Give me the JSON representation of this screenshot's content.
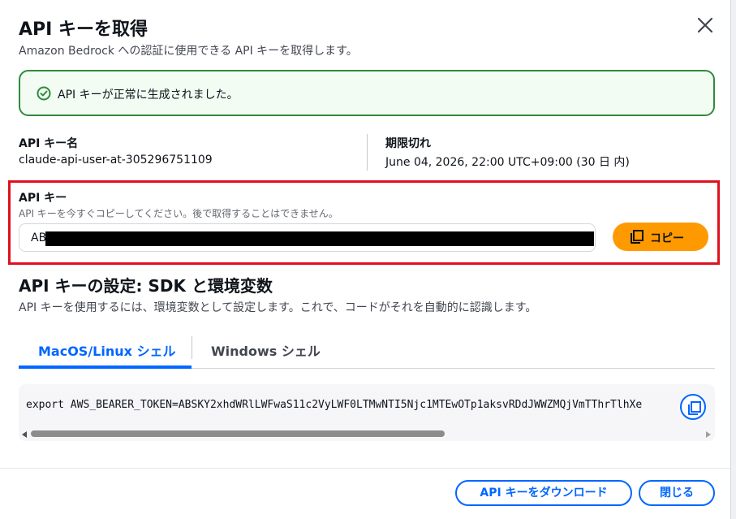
{
  "header": {
    "title": "API キーを取得",
    "subtitle": "Amazon Bedrock への認証に使用できる API キーを取得します。"
  },
  "alert": {
    "message": "API キーが正常に生成されました。",
    "icon": "check-circle-icon",
    "color": "#2f8a3d"
  },
  "details": {
    "name_label": "API キー名",
    "name_value": "claude-api-user-at-305296751109",
    "expiry_label": "期限切れ",
    "expiry_value": "June 04, 2026, 22:00 UTC+09:00 (30 日 内)"
  },
  "api_key": {
    "label": "API キー",
    "description": "API キーを今すぐコピーしてください。後で取得することはできません。",
    "value_visible_prefix": "AB",
    "copy_label": "コピー"
  },
  "setup": {
    "title": "API キーの設定: SDK と環境変数",
    "description": "API キーを使用するには、環境変数として設定します。これで、コードがそれを自動的に認識します。",
    "tabs": [
      {
        "label": "MacOS/Linux シェル",
        "active": true
      },
      {
        "label": "Windows シェル",
        "active": false
      }
    ],
    "code": "export AWS_BEARER_TOKEN=ABSKY2xhdWRlLWFwaS11c2VyLWF0LTMwNTI5Njc1MTEwOTp1aksvRDdJWWZMQjVmTThrTlhXe"
  },
  "footer": {
    "download_label": "API キーをダウンロード",
    "close_label": "閉じる"
  },
  "colors": {
    "accent": "#0066ff",
    "primary_button": "#ff9900",
    "highlight_border": "#e0101e"
  }
}
